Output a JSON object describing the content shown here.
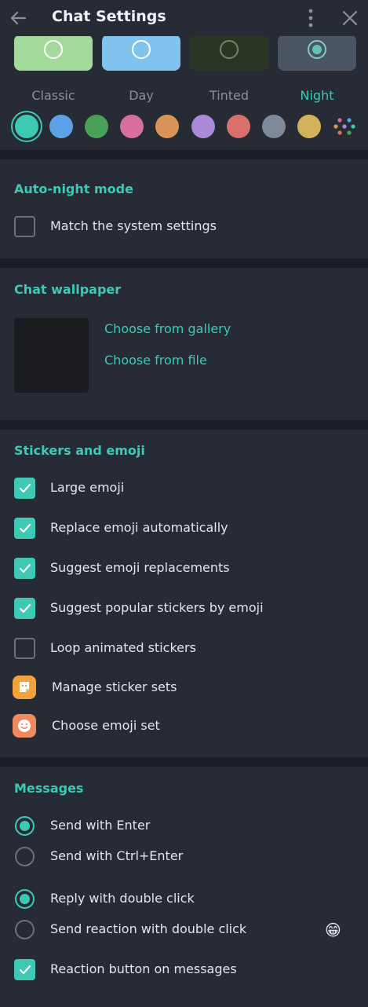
{
  "header": {
    "title": "Chat Settings"
  },
  "themes": [
    {
      "label": "Classic",
      "color": "#a3d99b",
      "active": false
    },
    {
      "label": "Day",
      "color": "#7fc3ee",
      "active": false
    },
    {
      "label": "Tinted",
      "color": "#2b3526",
      "active": false
    },
    {
      "label": "Night",
      "color": "#4c5663",
      "active": true
    }
  ],
  "accent_colors": [
    "#3ec9b5",
    "#5ba3e6",
    "#4aa059",
    "#d9709b",
    "#d99459",
    "#a98ad9",
    "#d9706d",
    "#7f8a98",
    "#d4b25c"
  ],
  "auto_night": {
    "title": "Auto-night mode",
    "match_system": "Match the system settings"
  },
  "wallpaper": {
    "title": "Chat wallpaper",
    "gallery": "Choose from gallery",
    "file": "Choose from file"
  },
  "stickers": {
    "title": "Stickers and emoji",
    "large_emoji": "Large emoji",
    "replace_emoji": "Replace emoji automatically",
    "suggest_replacements": "Suggest emoji replacements",
    "suggest_stickers": "Suggest popular stickers by emoji",
    "loop_stickers": "Loop animated stickers",
    "manage_sets": "Manage sticker sets",
    "emoji_set": "Choose emoji set"
  },
  "messages": {
    "title": "Messages",
    "send_enter": "Send with Enter",
    "send_ctrl_enter": "Send with Ctrl+Enter",
    "reply_double": "Reply with double click",
    "reaction_double": "Send reaction with double click",
    "reaction_emoji": "😁",
    "reaction_button": "Reaction button on messages"
  }
}
